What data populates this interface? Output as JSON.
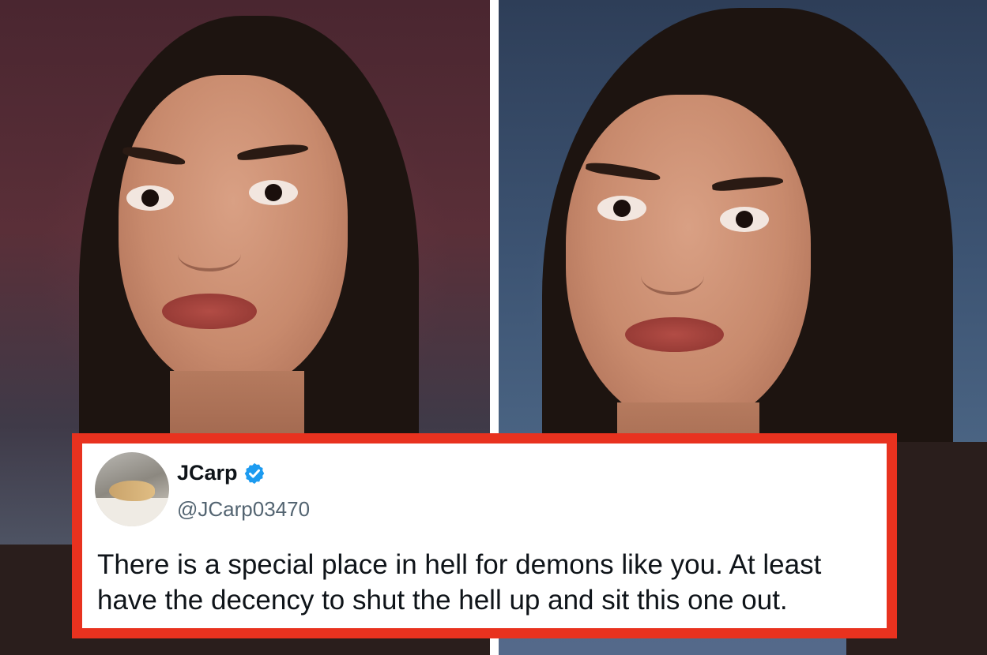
{
  "tweet": {
    "display_name": "JCarp",
    "handle": "@JCarp03470",
    "verified": true,
    "text": "There is a special place in hell for demons like you.  At least have the decency to shut the hell up and sit this one out."
  },
  "colors": {
    "frame_border": "#e8321f",
    "verified_badge": "#1d9bf0",
    "name_text": "#0f1419",
    "handle_text": "#536471"
  },
  "icons": [
    "verified-badge-icon"
  ]
}
